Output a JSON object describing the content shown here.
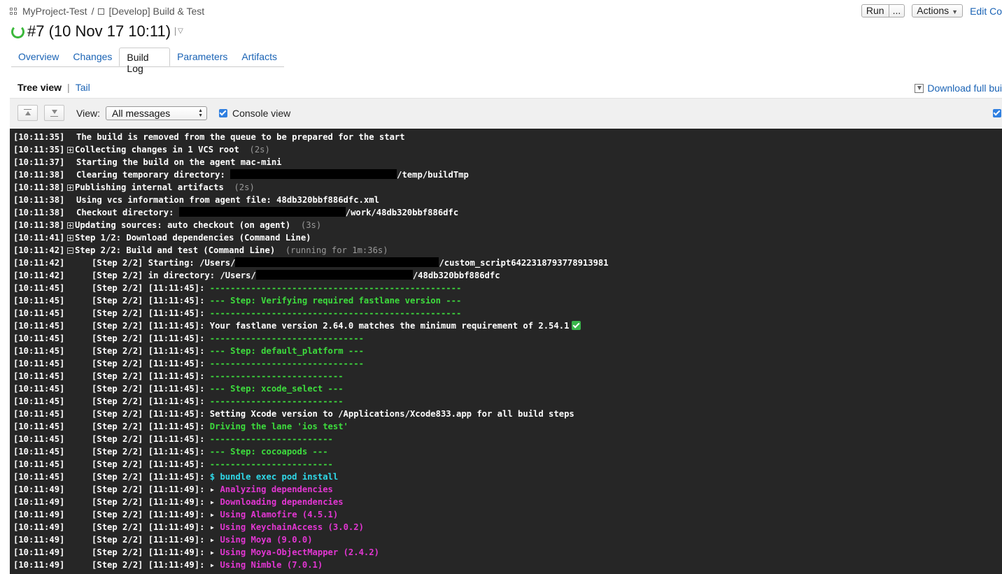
{
  "breadcrumb": {
    "project": "MyProject-Test",
    "separator": "/",
    "build_config": "[Develop] Build & Test"
  },
  "header": {
    "run_label": "Run",
    "run_more_label": "...",
    "actions_label": "Actions",
    "edit_label": "Edit Co"
  },
  "build": {
    "title": "#7 (10 Nov 17 10:11)"
  },
  "tabs": [
    {
      "label": "Overview"
    },
    {
      "label": "Changes"
    },
    {
      "label": "Build Log"
    },
    {
      "label": "Parameters"
    },
    {
      "label": "Artifacts"
    }
  ],
  "active_tab": "Build Log",
  "view_switch": {
    "tree_view": "Tree view",
    "separator": "|",
    "tail": "Tail",
    "download_label": "Download full bui"
  },
  "toolbar": {
    "view_label": "View:",
    "view_selected": "All messages",
    "console_view_label": "Console view",
    "console_view_checked": true
  },
  "log": [
    {
      "ts": "[10:11:35]",
      "text": "The build is removed from the queue to be prepared for the start"
    },
    {
      "ts": "[10:11:35]",
      "expander": "plus",
      "text": "Collecting changes in 1 VCS root",
      "dur": "(2s)"
    },
    {
      "ts": "[10:11:37]",
      "text": "Starting the build on the agent mac-mini"
    },
    {
      "ts": "[10:11:38]",
      "text": "Clearing temporary directory: ",
      "suffix": "/temp/buildTmp"
    },
    {
      "ts": "[10:11:38]",
      "expander": "plus",
      "text": "Publishing internal artifacts",
      "dur": "(2s)"
    },
    {
      "ts": "[10:11:38]",
      "text": "Using vcs information from agent file: 48db320bbf886dfc.xml"
    },
    {
      "ts": "[10:11:38]",
      "text": "Checkout directory: ",
      "suffix": "/work/48db320bbf886dfc"
    },
    {
      "ts": "[10:11:38]",
      "expander": "plus",
      "text": "Updating sources: auto checkout (on agent)",
      "dur": "(3s)"
    },
    {
      "ts": "[10:11:41]",
      "expander": "plus",
      "text": "Step 1/2: Download dependencies (Command Line)"
    },
    {
      "ts": "[10:11:42]",
      "expander": "minus",
      "text": "Step 2/2: Build and test (Command Line)",
      "dur": "(running for 1m:36s)"
    },
    {
      "ts": "[10:11:42]",
      "prefix": "[Step 2/2] Starting: /Users/",
      "suffix": "/custom_script6422318793778913981"
    },
    {
      "ts": "[10:11:42]",
      "prefix": "[Step 2/2] in directory: /Users/",
      "suffix": "/48db320bbf886dfc"
    },
    {
      "ts": "[10:11:45]",
      "prefix": "[Step 2/2] [11:11:45]: ",
      "text": "-------------------------------------------------",
      "color": "green"
    },
    {
      "ts": "[10:11:45]",
      "prefix": "[Step 2/2] [11:11:45]: ",
      "text": "--- Step: Verifying required fastlane version ---",
      "color": "green"
    },
    {
      "ts": "[10:11:45]",
      "prefix": "[Step 2/2] [11:11:45]: ",
      "text": "-------------------------------------------------",
      "color": "green"
    },
    {
      "ts": "[10:11:45]",
      "prefix": "[Step 2/2] [11:11:45]: ",
      "text": "Your fastlane version 2.64.0 matches the minimum requirement of 2.54.1",
      "emoji": "check-mark-icon"
    },
    {
      "ts": "[10:11:45]",
      "prefix": "[Step 2/2] [11:11:45]: ",
      "text": "------------------------------",
      "color": "green"
    },
    {
      "ts": "[10:11:45]",
      "prefix": "[Step 2/2] [11:11:45]: ",
      "text": "--- Step: default_platform ---",
      "color": "green"
    },
    {
      "ts": "[10:11:45]",
      "prefix": "[Step 2/2] [11:11:45]: ",
      "text": "------------------------------",
      "color": "green"
    },
    {
      "ts": "[10:11:45]",
      "prefix": "[Step 2/2] [11:11:45]: ",
      "text": "--------------------------",
      "color": "green"
    },
    {
      "ts": "[10:11:45]",
      "prefix": "[Step 2/2] [11:11:45]: ",
      "text": "--- Step: xcode_select ---",
      "color": "green"
    },
    {
      "ts": "[10:11:45]",
      "prefix": "[Step 2/2] [11:11:45]: ",
      "text": "--------------------------",
      "color": "green"
    },
    {
      "ts": "[10:11:45]",
      "prefix": "[Step 2/2] [11:11:45]: ",
      "text": "Setting Xcode version to /Applications/Xcode833.app for all build steps"
    },
    {
      "ts": "[10:11:45]",
      "prefix": "[Step 2/2] [11:11:45]: ",
      "text": "Driving the lane 'ios test'",
      "color": "green"
    },
    {
      "ts": "[10:11:45]",
      "prefix": "[Step 2/2] [11:11:45]: ",
      "text": "------------------------",
      "color": "green"
    },
    {
      "ts": "[10:11:45]",
      "prefix": "[Step 2/2] [11:11:45]: ",
      "text": "--- Step: cocoapods ---",
      "color": "green"
    },
    {
      "ts": "[10:11:45]",
      "prefix": "[Step 2/2] [11:11:45]: ",
      "text": "------------------------",
      "color": "green"
    },
    {
      "ts": "[10:11:45]",
      "prefix": "[Step 2/2] [11:11:45]: ",
      "text": "$ bundle exec pod install",
      "color": "cyan"
    },
    {
      "ts": "[10:11:49]",
      "prefix": "[Step 2/2] [11:11:49]: ",
      "bullet": "▸ ",
      "text": "Analyzing dependencies",
      "color": "magenta"
    },
    {
      "ts": "[10:11:49]",
      "prefix": "[Step 2/2] [11:11:49]: ",
      "bullet": "▸ ",
      "text": "Downloading dependencies",
      "color": "magenta"
    },
    {
      "ts": "[10:11:49]",
      "prefix": "[Step 2/2] [11:11:49]: ",
      "bullet": "▸ ",
      "text": "Using Alamofire (4.5.1)",
      "color": "magenta"
    },
    {
      "ts": "[10:11:49]",
      "prefix": "[Step 2/2] [11:11:49]: ",
      "bullet": "▸ ",
      "text": "Using KeychainAccess (3.0.2)",
      "color": "magenta"
    },
    {
      "ts": "[10:11:49]",
      "prefix": "[Step 2/2] [11:11:49]: ",
      "bullet": "▸ ",
      "text": "Using Moya (9.0.0)",
      "color": "magenta"
    },
    {
      "ts": "[10:11:49]",
      "prefix": "[Step 2/2] [11:11:49]: ",
      "bullet": "▸ ",
      "text": "Using Moya-ObjectMapper (2.4.2)",
      "color": "magenta"
    },
    {
      "ts": "[10:11:49]",
      "prefix": "[Step 2/2] [11:11:49]: ",
      "bullet": "▸ ",
      "text": "Using Nimble (7.0.1)",
      "color": "magenta"
    }
  ]
}
